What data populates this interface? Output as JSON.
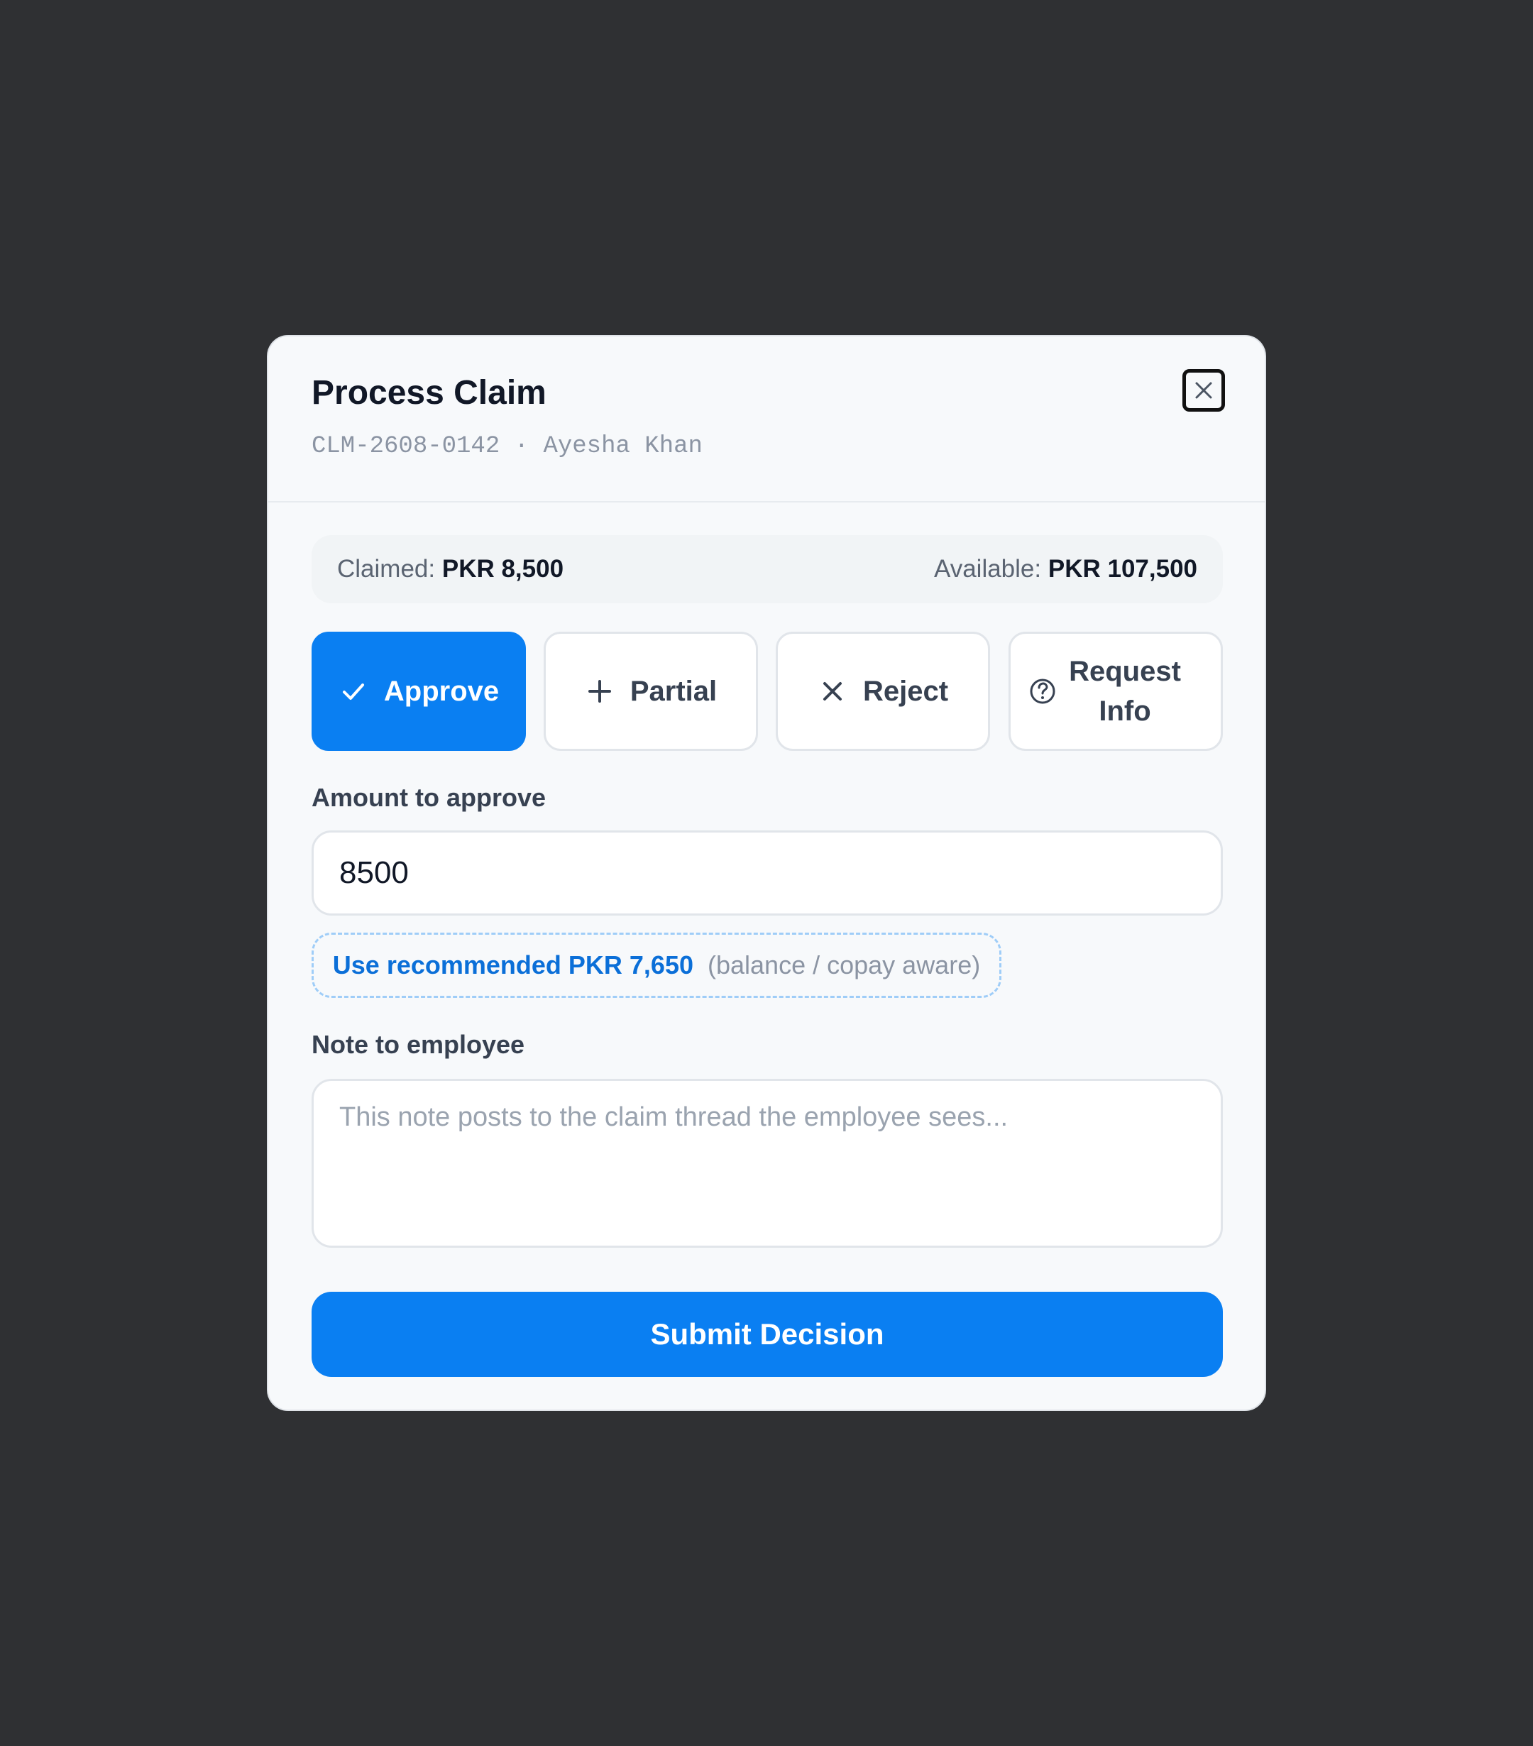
{
  "dialog": {
    "title": "Process Claim",
    "claim_id": "CLM-2608-0142",
    "separator": "·",
    "employee_name": "Ayesha Khan",
    "close_icon": "close-icon"
  },
  "summary": {
    "claimed_label": "Claimed:",
    "claimed_value": "PKR 8,500",
    "available_label": "Available:",
    "available_value": "PKR 107,500"
  },
  "decision_options": [
    {
      "label": "Approve",
      "icon": "check-icon",
      "selected": true
    },
    {
      "label": "Partial",
      "icon": "plus-icon",
      "selected": false
    },
    {
      "label": "Reject",
      "icon": "close-icon",
      "selected": false
    },
    {
      "label": "Request Info",
      "icon": "question-circle-icon",
      "selected": false
    }
  ],
  "amount_field": {
    "label": "Amount to approve",
    "value": "8500"
  },
  "recommendation": {
    "text": "Use recommended PKR 7,650",
    "hint": "(balance / copay aware)"
  },
  "note_field": {
    "label": "Note to employee",
    "value": "",
    "placeholder": "This note posts to the claim thread the employee sees..."
  },
  "submit": {
    "label": "Submit Decision"
  },
  "colors": {
    "background": "#2f3033",
    "modal": "#f7f9fb",
    "primary": "#0a7ff2",
    "link": "#0b6fd8",
    "text": "#111827",
    "muted": "#8b94a3"
  }
}
